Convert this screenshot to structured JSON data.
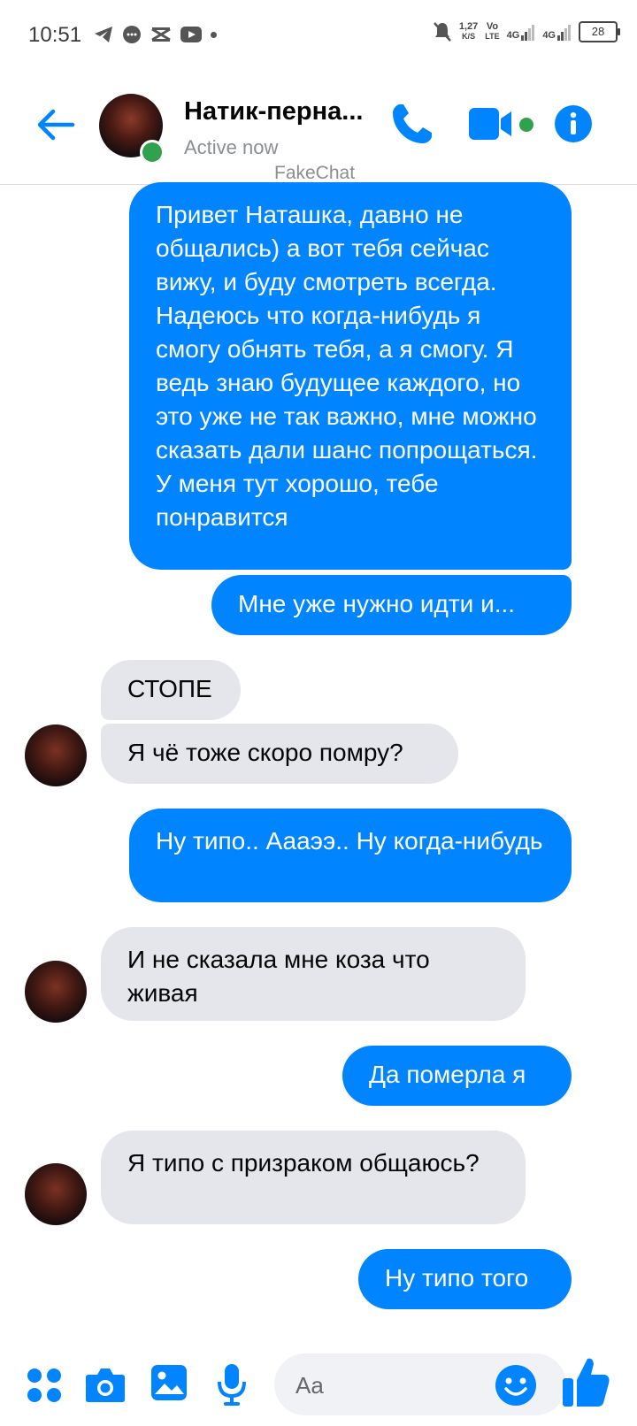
{
  "status_bar": {
    "time": "10:51",
    "net_speed_value": "1,27",
    "net_speed_unit": "K/S",
    "volte_top": "Vo",
    "volte_bottom": "LTE",
    "signal1_label": "4G",
    "signal2_label": "4G",
    "battery": "28"
  },
  "header": {
    "contact_name": "Натик-перна...",
    "contact_status": "Active now",
    "watermark": "FakeChat"
  },
  "messages": [
    {
      "direction": "outgoing",
      "text": "Привет Наташка, давно не общались) а вот тебя сейчас вижу, и буду смотреть всегда. Надеюсь что когда-нибудь я смогу обнять тебя, а я смогу. Я ведь знаю будущее каждого, но это уже не так важно, мне можно сказать дали шанс попрощаться. У меня тут хорошо, тебе понравится"
    },
    {
      "direction": "outgoing",
      "text": "Мне уже нужно идти и..."
    },
    {
      "direction": "incoming",
      "text": "СТОПЕ"
    },
    {
      "direction": "incoming",
      "text": "Я чё тоже скоро помру?"
    },
    {
      "direction": "outgoing",
      "text": "Ну типо.. Аааээ.. Ну когда-нибудь"
    },
    {
      "direction": "incoming",
      "text": "И не сказала мне коза что живая"
    },
    {
      "direction": "outgoing",
      "text": "Да померла я"
    },
    {
      "direction": "incoming",
      "text": "Я типо с призраком общаюсь?"
    },
    {
      "direction": "outgoing",
      "text": "Ну типо того"
    }
  ],
  "composer": {
    "placeholder": "Aa"
  },
  "colors": {
    "accent": "#0084ff",
    "outgoing_bubble": "#0084ff",
    "incoming_bubble": "#e4e6eb",
    "online": "#31a24c"
  },
  "icons": [
    "back-arrow-icon",
    "phone-icon",
    "video-camera-icon",
    "info-icon",
    "menu-dots-icon",
    "camera-icon",
    "image-icon",
    "microphone-icon",
    "emoji-icon",
    "thumbs-up-icon"
  ]
}
